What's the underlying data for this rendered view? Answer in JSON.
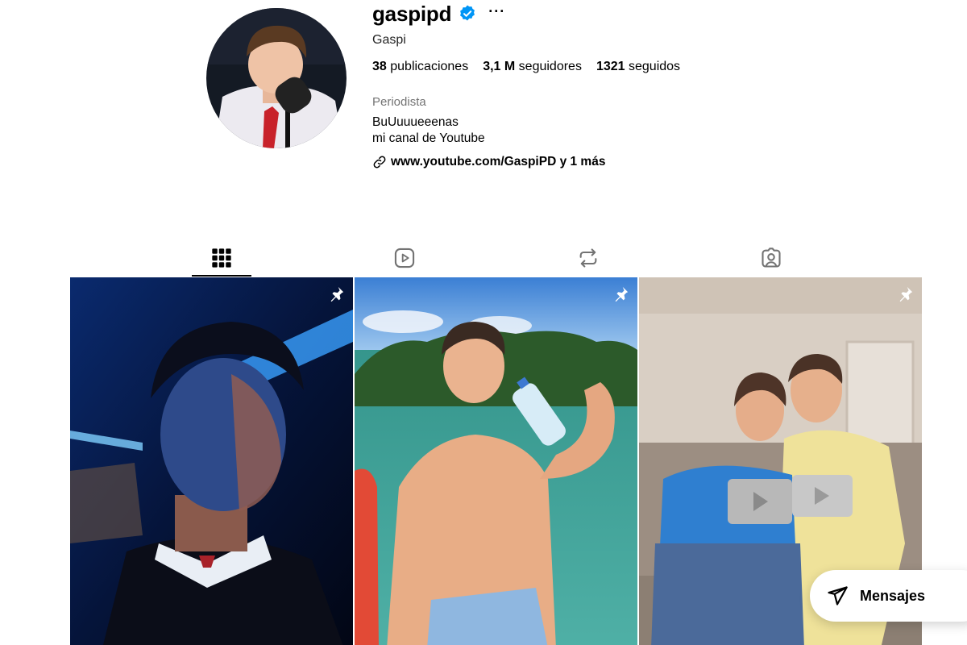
{
  "profile": {
    "username": "gaspipd",
    "verified": true,
    "more_label": "···",
    "full_name": "Gaspi",
    "stats": {
      "posts_count": "38",
      "posts_label": "publicaciones",
      "followers_count": "3,1 M",
      "followers_label": "seguidores",
      "following_count": "1321",
      "following_label": "seguidos"
    },
    "category": "Periodista",
    "bio_lines": [
      "BuUuuueeenas",
      "mi canal de Youtube"
    ],
    "link_text": "www.youtube.com/GaspiPD y 1 más"
  },
  "tabs": [
    {
      "name": "posts",
      "icon": "grid-icon",
      "active": true
    },
    {
      "name": "reels",
      "icon": "reels-icon",
      "active": false
    },
    {
      "name": "reposts",
      "icon": "repost-icon",
      "active": false
    },
    {
      "name": "tagged",
      "icon": "tagged-icon",
      "active": false
    }
  ],
  "posts": [
    {
      "pinned": true,
      "icon": "pin-icon"
    },
    {
      "pinned": true,
      "icon": "pin-icon"
    },
    {
      "pinned": true,
      "icon": "pin-icon"
    }
  ],
  "messages_button": {
    "label": "Mensajes",
    "icon": "paper-plane-icon"
  },
  "colors": {
    "verified_blue": "#0095f6",
    "secondary_text": "#737373"
  }
}
